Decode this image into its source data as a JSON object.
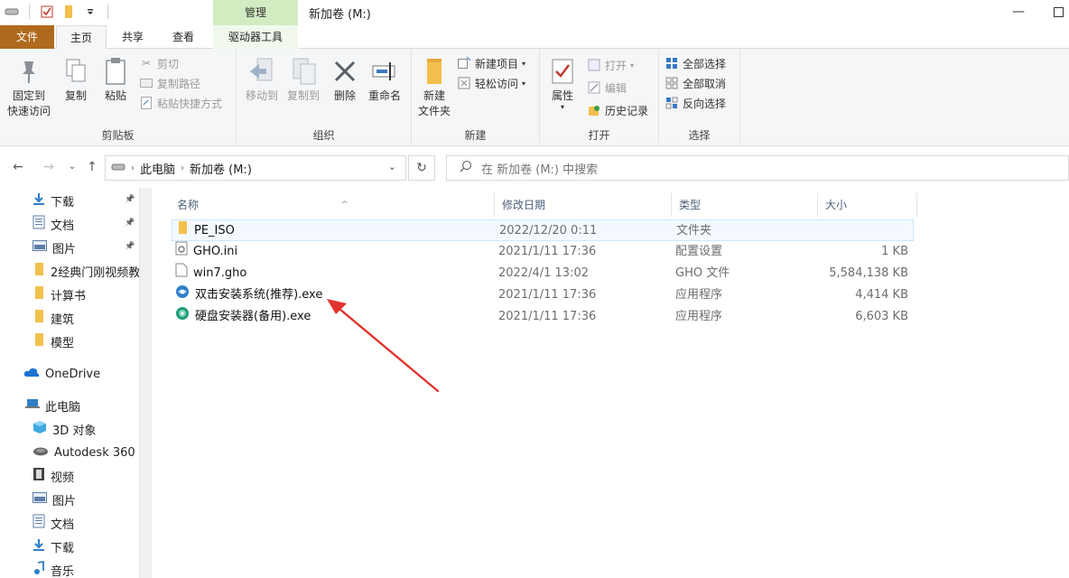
{
  "window": {
    "title": "新加卷 (M:)",
    "context_tab": "管理"
  },
  "tabs": [
    "文件",
    "主页",
    "共享",
    "查看",
    "驱动器工具"
  ],
  "ribbon": {
    "clipboard": {
      "label": "剪贴板",
      "pin": "固定到快速访问",
      "pin_l1": "固定到",
      "pin_l2": "快速访问",
      "copy": "复制",
      "paste": "粘贴",
      "cut": "剪切",
      "copy_path": "复制路径",
      "paste_shortcut": "粘贴快捷方式"
    },
    "organize": {
      "label": "组织",
      "move_to": "移动到",
      "copy_to": "复制到",
      "delete": "删除",
      "rename": "重命名"
    },
    "new": {
      "label": "新建",
      "new_item": "新建项目",
      "easy_access": "轻松访问",
      "new_folder_l1": "新建",
      "new_folder_l2": "文件夹"
    },
    "open": {
      "label": "打开",
      "properties": "属性",
      "open": "打开",
      "edit": "编辑",
      "history": "历史记录"
    },
    "select": {
      "label": "选择",
      "select_all": "全部选择",
      "select_none": "全部取消",
      "invert": "反向选择"
    }
  },
  "address": {
    "path": [
      "此电脑",
      "新加卷 (M:)"
    ],
    "search_placeholder": "在 新加卷 (M:) 中搜索"
  },
  "nav": {
    "quick": [
      {
        "label": "下载",
        "icon": "download-arrow-icon",
        "pinned": true
      },
      {
        "label": "文档",
        "icon": "document-icon",
        "pinned": true
      },
      {
        "label": "图片",
        "icon": "picture-icon",
        "pinned": true
      },
      {
        "label": "2经典门刚视频教",
        "icon": "folder-icon",
        "pinned": false
      },
      {
        "label": "计算书",
        "icon": "folder-icon",
        "pinned": false
      },
      {
        "label": "建筑",
        "icon": "folder-icon",
        "pinned": false
      },
      {
        "label": "模型",
        "icon": "folder-icon",
        "pinned": false
      }
    ],
    "onedrive": "OneDrive",
    "this_pc": "此电脑",
    "pc_items": [
      {
        "label": "3D 对象",
        "icon": "cube-icon"
      },
      {
        "label": "Autodesk 360",
        "icon": "cloud-drive-icon"
      },
      {
        "label": "视频",
        "icon": "film-icon"
      },
      {
        "label": "图片",
        "icon": "picture-icon"
      },
      {
        "label": "文档",
        "icon": "document-icon"
      },
      {
        "label": "下载",
        "icon": "download-arrow-icon"
      },
      {
        "label": "音乐",
        "icon": "music-note-icon"
      }
    ]
  },
  "columns": {
    "name": "名称",
    "date": "修改日期",
    "type": "类型",
    "size": "大小"
  },
  "files": [
    {
      "name": "PE_ISO",
      "date": "2022/12/20 0:11",
      "type": "文件夹",
      "size": "",
      "icon": "folder-icon"
    },
    {
      "name": "GHO.ini",
      "date": "2021/1/11 17:36",
      "type": "配置设置",
      "size": "1 KB",
      "icon": "settings-file-icon"
    },
    {
      "name": "win7.gho",
      "date": "2022/4/1 13:02",
      "type": "GHO 文件",
      "size": "5,584,138 KB",
      "icon": "blank-file-icon"
    },
    {
      "name": "双击安装系统(推荐).exe",
      "date": "2021/1/11 17:36",
      "type": "应用程序",
      "size": "4,414 KB",
      "icon": "installer-globe-icon"
    },
    {
      "name": "硬盘安装器(备用).exe",
      "date": "2021/1/11 17:36",
      "type": "应用程序",
      "size": "6,603 KB",
      "icon": "installer-disk-icon"
    }
  ],
  "colors": {
    "file_tab": "#b06a1d",
    "context_tab": "#d2ecc2",
    "accent": "#1979ca",
    "annotation_arrow": "#e3342f"
  }
}
